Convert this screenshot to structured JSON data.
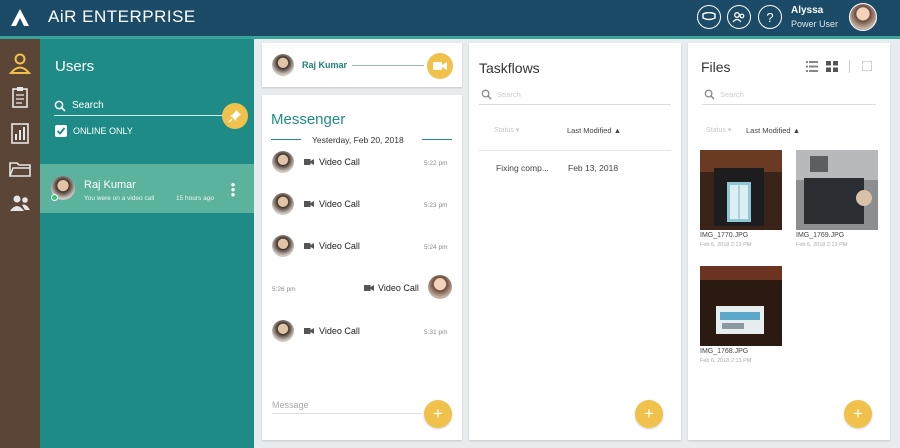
{
  "app": {
    "title": "AiR ENTERPRISE",
    "accent_color": "#1e8b86",
    "topbar_color": "#1b4b66",
    "fab_color": "#f0c24b"
  },
  "header": {
    "user_name": "Alyssa",
    "user_role": "Power User",
    "icons": [
      "chat-bubble-icon",
      "contacts-icon",
      "help-icon"
    ],
    "help_glyph": "?"
  },
  "rail": {
    "items": [
      "profile-icon",
      "clipboard-icon",
      "bar-chart-icon",
      "folder-icon",
      "users-icon"
    ]
  },
  "users": {
    "title": "Users",
    "search_label": "Search",
    "online_only_label": "ONLINE ONLY",
    "online_only_checked": true,
    "list": [
      {
        "name": "Raj Kumar",
        "last_message": "You were on a video call",
        "time": "15 hours ago",
        "online": true
      }
    ]
  },
  "contact": {
    "name": "Raj Kumar"
  },
  "messenger": {
    "title": "Messenger",
    "date_divider": "Yesterday, Feb 20, 2018",
    "input_placeholder": "Message",
    "messages": [
      {
        "text": "Video Call",
        "time": "5:22 pm",
        "from": "Raj Kumar"
      },
      {
        "text": "Video Call",
        "time": "5:23 pm",
        "from": "Raj Kumar"
      },
      {
        "text": "Video Call",
        "time": "5:24 pm",
        "from": "Raj Kumar"
      },
      {
        "text": "Video Call",
        "time": "5:26 pm",
        "from": "Alyssa"
      },
      {
        "text": "Video Call",
        "time": "5:31 pm",
        "from": "Raj Kumar"
      }
    ]
  },
  "taskflows": {
    "title": "Taskflows",
    "search_placeholder": "Search",
    "columns": {
      "status": "Status",
      "modified": "Last Modified"
    },
    "rows": [
      {
        "name": "Fixing comp...",
        "modified": "Feb 13, 2018"
      }
    ]
  },
  "files": {
    "title": "Files",
    "search_placeholder": "Search",
    "columns": {
      "status": "Status",
      "modified": "Last Modified"
    },
    "items": [
      {
        "name": "IMG_1770.JPG",
        "date": "Feb 6, 2018 2:13 PM"
      },
      {
        "name": "IMG_1769.JPG",
        "date": "Feb 6, 2018 2:13 PM"
      },
      {
        "name": "IMG_1768.JPG",
        "date": "Feb 6, 2018 2:13 PM"
      }
    ]
  },
  "fab_label": "+"
}
